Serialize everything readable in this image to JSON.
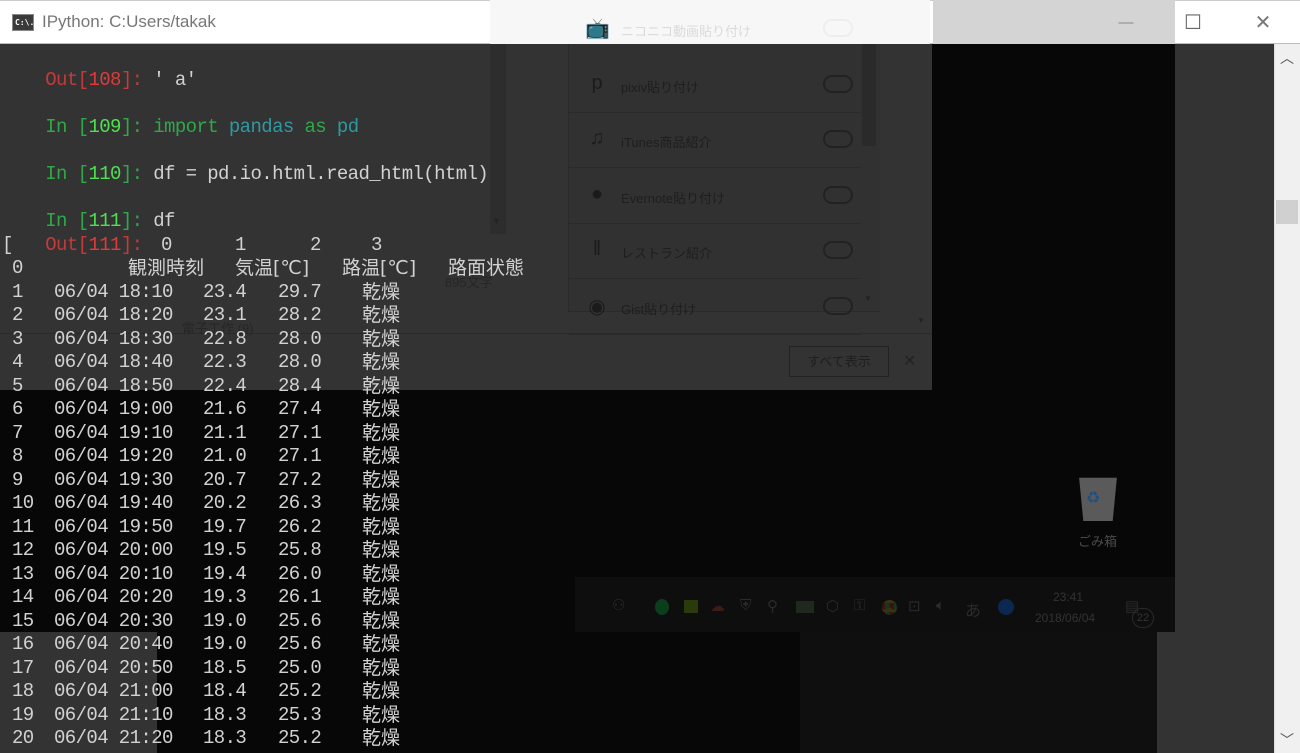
{
  "window": {
    "title": "IPython: C:Users/takak",
    "icon_label": "C:\\.",
    "minimize_label": "—",
    "maximize_label": "☐",
    "close_label": "✕"
  },
  "terminal": {
    "out108": {
      "prefix": "Out[",
      "num": "108",
      "suffix": "]: ",
      "value": "' a'"
    },
    "in109": {
      "prefix": "In [",
      "num": "109",
      "suffix": "]: ",
      "kw1": "import",
      "mod": "pandas",
      "kw2": "as",
      "alias": "pd"
    },
    "in110": {
      "prefix": "In [",
      "num": "110",
      "suffix": "]: ",
      "code": "df = pd.io.html.read_html(html)"
    },
    "in111": {
      "prefix": "In [",
      "num": "111",
      "suffix": "]: ",
      "code": "df"
    },
    "out111": {
      "prefix": "Out[",
      "num": "111",
      "suffix": "]:"
    },
    "bracket": "[",
    "column_indices": [
      "0",
      "1",
      "2",
      "3"
    ],
    "header": {
      "index": "0",
      "cols": [
        "観測時刻",
        "気温[℃]",
        "路温[℃]",
        "路面状態"
      ]
    },
    "rows": [
      [
        "1",
        "06/04 18:10",
        "23.4",
        "29.7",
        "乾燥"
      ],
      [
        "2",
        "06/04 18:20",
        "23.1",
        "28.2",
        "乾燥"
      ],
      [
        "3",
        "06/04 18:30",
        "22.8",
        "28.0",
        "乾燥"
      ],
      [
        "4",
        "06/04 18:40",
        "22.3",
        "28.0",
        "乾燥"
      ],
      [
        "5",
        "06/04 18:50",
        "22.4",
        "28.4",
        "乾燥"
      ],
      [
        "6",
        "06/04 19:00",
        "21.6",
        "27.4",
        "乾燥"
      ],
      [
        "7",
        "06/04 19:10",
        "21.1",
        "27.1",
        "乾燥"
      ],
      [
        "8",
        "06/04 19:20",
        "21.0",
        "27.1",
        "乾燥"
      ],
      [
        "9",
        "06/04 19:30",
        "20.7",
        "27.2",
        "乾燥"
      ],
      [
        "10",
        "06/04 19:40",
        "20.2",
        "26.3",
        "乾燥"
      ],
      [
        "11",
        "06/04 19:50",
        "19.7",
        "26.2",
        "乾燥"
      ],
      [
        "12",
        "06/04 20:00",
        "19.5",
        "25.8",
        "乾燥"
      ],
      [
        "13",
        "06/04 20:10",
        "19.4",
        "26.0",
        "乾燥"
      ],
      [
        "14",
        "06/04 20:20",
        "19.3",
        "26.1",
        "乾燥"
      ],
      [
        "15",
        "06/04 20:30",
        "19.0",
        "25.6",
        "乾燥"
      ],
      [
        "16",
        "06/04 20:40",
        "19.0",
        "25.6",
        "乾燥"
      ],
      [
        "17",
        "06/04 20:50",
        "18.5",
        "25.0",
        "乾燥"
      ],
      [
        "18",
        "06/04 21:00",
        "18.4",
        "25.2",
        "乾燥"
      ],
      [
        "19",
        "06/04 21:10",
        "18.3",
        "25.3",
        "乾燥"
      ],
      [
        "20",
        "06/04 21:20",
        "18.3",
        "25.2",
        "乾燥"
      ]
    ]
  },
  "background_browser": {
    "items": [
      {
        "icon": "tv-icon",
        "glyph": "📺",
        "label": "ニコニコ動画貼り付け"
      },
      {
        "icon": "pixiv-icon",
        "glyph": "p",
        "label": "pixiv貼り付け"
      },
      {
        "icon": "music-note-icon",
        "glyph": "♫",
        "label": "iTunes商品紹介"
      },
      {
        "icon": "evernote-icon",
        "glyph": "●",
        "label": "Evernote貼り付け"
      },
      {
        "icon": "fork-knife-icon",
        "glyph": "ǁ",
        "label": "レストラン紹介"
      },
      {
        "icon": "github-icon",
        "glyph": "◉",
        "label": "Gist貼り付け"
      }
    ],
    "char_count": "895文字",
    "category": "電子工作 (9)",
    "show_all_label": "すべて表示",
    "close_label": "✕"
  },
  "desktop": {
    "recycle_bin_label": "ごみ箱",
    "clock_time": "23:41",
    "clock_date": "2018/06/04",
    "ime_label": "あ",
    "notification_count": "22"
  }
}
